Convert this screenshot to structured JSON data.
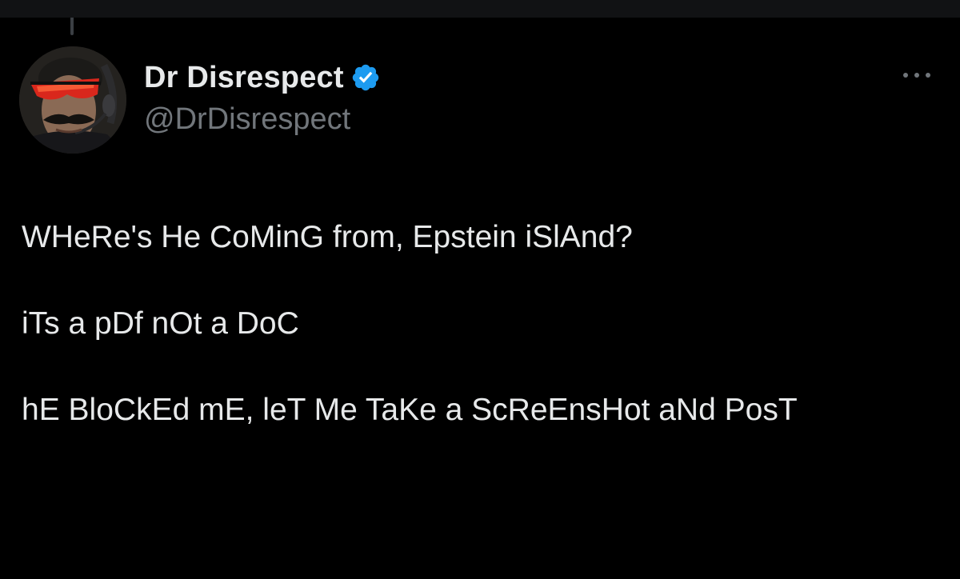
{
  "tweet": {
    "author": {
      "display_name": "Dr Disrespect",
      "handle": "@DrDisrespect",
      "verified": true,
      "verified_icon": "verified-badge-icon",
      "avatar": "avatar-image"
    },
    "more_icon": "more-options-icon",
    "paragraphs": [
      "WHeRe's He CoMinG from, Epstein iSlAnd?",
      "iTs a pDf nOt a DoC",
      "hE BloCkEd mE, leT Me TaKe a ScReEnsHot aNd PosT"
    ]
  },
  "colors": {
    "background": "#000000",
    "top_bar": "#111214",
    "text_primary": "#e7e9ea",
    "text_secondary": "#71767b",
    "verified_blue": "#1d9bf0"
  }
}
